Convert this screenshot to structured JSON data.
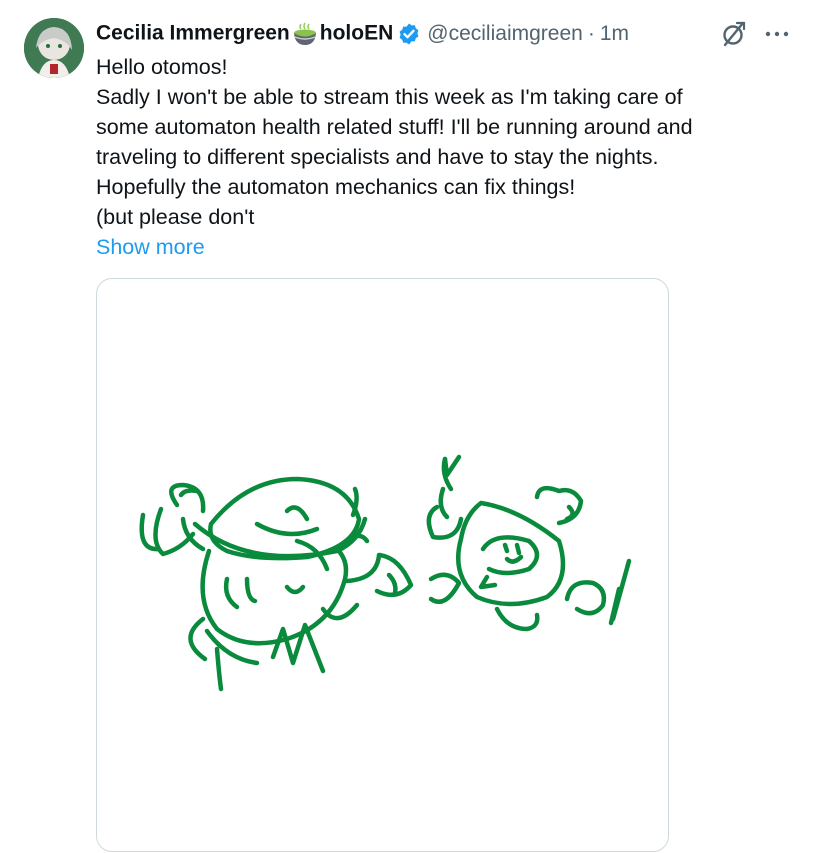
{
  "author": {
    "display_name_part1": "Cecilia Immergreen",
    "display_name_part2": "holoEN",
    "handle": "@ceciliaimgreen",
    "separator": "·",
    "time": "1m"
  },
  "icons": {
    "avatar": "avatar-image",
    "name_emoji": "matcha-tea-bowl-icon",
    "verified": "verified-badge-icon",
    "grok": "grok-icon",
    "more": "more-options-icon"
  },
  "colors": {
    "verified": "#1d9bf0",
    "link": "#1d9bf0",
    "secondary_text": "#536471",
    "drawing": "#0a8a3c"
  },
  "tweet": {
    "lines": [
      "Hello otomos!",
      "Sadly I won't be able to stream this week as I'm taking care of",
      "some automaton health related stuff! I'll be running around and",
      "traveling to different specialists and have to stay the nights.",
      "Hopefully the automaton mechanics can fix things!",
      "(but please don't"
    ],
    "show_more": "Show more"
  }
}
